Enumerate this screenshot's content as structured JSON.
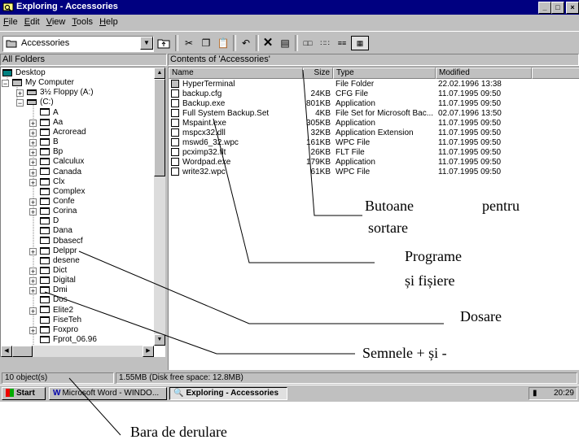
{
  "window": {
    "title": "Exploring - Accessories",
    "controls": [
      "_",
      "□",
      "×"
    ]
  },
  "menu": [
    "File",
    "Edit",
    "View",
    "Tools",
    "Help"
  ],
  "toolbar": {
    "address_value": "Accessories",
    "buttons": [
      "up-folder",
      "cut",
      "copy",
      "paste",
      "undo",
      "delete",
      "properties",
      "large-icons",
      "small-icons",
      "list",
      "details"
    ]
  },
  "tree_header": "All Folders",
  "list_header": "Contents of 'Accessories'",
  "tree": [
    {
      "label": "Desktop"
    },
    {
      "label": "My Computer"
    },
    {
      "label": "3½ Floppy (A:)"
    },
    {
      "label": "(C:)"
    },
    {
      "label": "A"
    },
    {
      "label": "Aa"
    },
    {
      "label": "Acroread"
    },
    {
      "label": "B"
    },
    {
      "label": "Bp"
    },
    {
      "label": "Calculux"
    },
    {
      "label": "Canada"
    },
    {
      "label": "Clx"
    },
    {
      "label": "Complex"
    },
    {
      "label": "Confe"
    },
    {
      "label": "Corina"
    },
    {
      "label": "D"
    },
    {
      "label": "Dana"
    },
    {
      "label": "Dbasecf"
    },
    {
      "label": "Delppr"
    },
    {
      "label": "desene"
    },
    {
      "label": "Dict"
    },
    {
      "label": "Digital"
    },
    {
      "label": "Dmi"
    },
    {
      "label": "Dos"
    },
    {
      "label": "Elite2"
    },
    {
      "label": "FiseTeh"
    },
    {
      "label": "Foxpro"
    },
    {
      "label": "Fprot_06.96"
    }
  ],
  "columns": [
    "Name",
    "Size",
    "Type",
    "Modified"
  ],
  "files": [
    {
      "name": "HyperTerminal",
      "size": "",
      "type": "File Folder",
      "modified": "22.02.1996 13:38"
    },
    {
      "name": "backup.cfg",
      "size": "24KB",
      "type": "CFG File",
      "modified": "11.07.1995 09:50"
    },
    {
      "name": "Backup.exe",
      "size": "801KB",
      "type": "Application",
      "modified": "11.07.1995 09:50"
    },
    {
      "name": "Full System Backup.Set",
      "size": "4KB",
      "type": "File Set for Microsoft Bac...",
      "modified": "02.07.1996 13:50"
    },
    {
      "name": "Mspaint.exe",
      "size": "305KB",
      "type": "Application",
      "modified": "11.07.1995 09:50"
    },
    {
      "name": "mspcx32.dll",
      "size": "32KB",
      "type": "Application Extension",
      "modified": "11.07.1995 09:50"
    },
    {
      "name": "mswd6_32.wpc",
      "size": "161KB",
      "type": "WPC File",
      "modified": "11.07.1995 09:50"
    },
    {
      "name": "pcximp32.flt",
      "size": "26KB",
      "type": "FLT File",
      "modified": "11.07.1995 09:50"
    },
    {
      "name": "Wordpad.exe",
      "size": "179KB",
      "type": "Application",
      "modified": "11.07.1995 09:50"
    },
    {
      "name": "write32.wpc",
      "size": "61KB",
      "type": "WPC File",
      "modified": "11.07.1995 09:50"
    }
  ],
  "status": {
    "objects": "10 object(s)",
    "disk": "1.55MB (Disk free space: 12.8MB)"
  },
  "taskbar": {
    "start": "Start",
    "tasks": [
      "Microsoft Word - WINDO...",
      "Exploring - Accessories"
    ],
    "clock": "20:29"
  },
  "annotations": {
    "sort_buttons_1": "Butoane",
    "sort_buttons_2": "pentru",
    "sort_buttons_3": "sortare",
    "programs_1": "Programe",
    "programs_2": "și fișiere",
    "folders": "Dosare",
    "plus_minus": "Semnele + și -",
    "scrollbar": "Bara de derulare"
  }
}
